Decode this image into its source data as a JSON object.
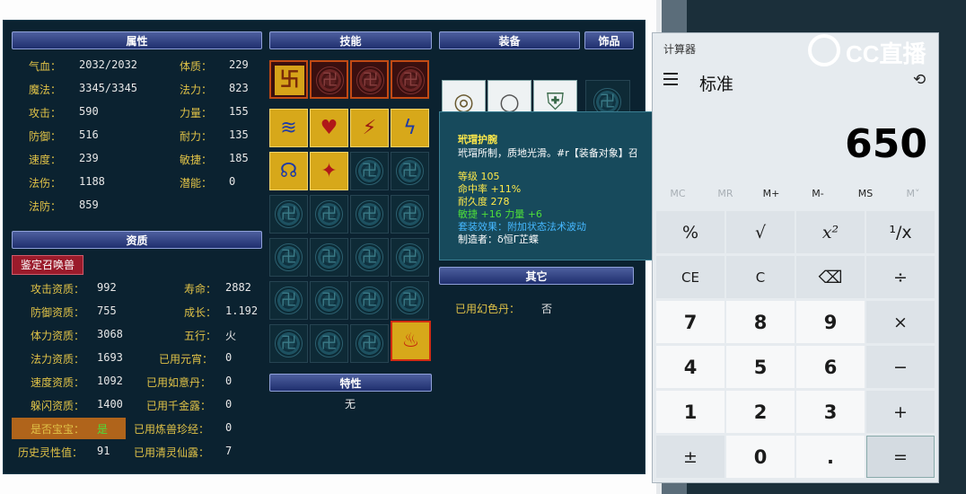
{
  "game": {
    "headers": {
      "attributes": "属性",
      "skills": "技能",
      "equipment": "装备",
      "accessories": "饰品",
      "aptitude": "资质",
      "other": "其它",
      "traits": "特性"
    },
    "attributes": [
      {
        "label": "气血：",
        "value": "2032/2032"
      },
      {
        "label": "魔法：",
        "value": "3345/3345"
      },
      {
        "label": "攻击：",
        "value": "590"
      },
      {
        "label": "防御：",
        "value": "516"
      },
      {
        "label": "速度：",
        "value": "239"
      },
      {
        "label": "法伤：",
        "value": "1188"
      },
      {
        "label": "法防：",
        "value": "859"
      }
    ],
    "attributes_right": [
      {
        "label": "体质：",
        "value": "229"
      },
      {
        "label": "法力：",
        "value": "823"
      },
      {
        "label": "力量：",
        "value": "155"
      },
      {
        "label": "耐力：",
        "value": "135"
      },
      {
        "label": "敏捷：",
        "value": "185"
      },
      {
        "label": "潜能：",
        "value": "0"
      }
    ],
    "appraise_button": "鉴定召唤兽",
    "aptitude_left": [
      {
        "label": "攻击资质：",
        "value": "992"
      },
      {
        "label": "防御资质：",
        "value": "755"
      },
      {
        "label": "体力资质：",
        "value": "3068"
      },
      {
        "label": "法力资质：",
        "value": "1693"
      },
      {
        "label": "速度资质：",
        "value": "1092"
      },
      {
        "label": "躲闪资质：",
        "value": "1400"
      },
      {
        "label": "是否宝宝：",
        "value": "是"
      },
      {
        "label": "历史灵性值：",
        "value": "91"
      }
    ],
    "aptitude_right": [
      {
        "label": "寿命：",
        "value": "2882"
      },
      {
        "label": "成长：",
        "value": "1.192"
      },
      {
        "label": "五行：",
        "value": "火"
      },
      {
        "label": "已用元宵：",
        "value": "0"
      },
      {
        "label": "已用如意丹：",
        "value": "0"
      },
      {
        "label": "已用千金露：",
        "value": "0"
      },
      {
        "label": "已用炼兽珍经：",
        "value": "0"
      },
      {
        "label": "已用清灵仙露：",
        "value": "7"
      }
    ],
    "other": {
      "label": "已用幻色丹：",
      "value": "否"
    },
    "traits_value": "无",
    "tooltip": {
      "name": "玳瑁护腕",
      "desc": "玳瑁所制，质地光滑。#r【装备对象】召",
      "level": "等级 105",
      "hit": "命中率 +11%",
      "durability": "耐久度 278",
      "stats": "敏捷 +16 力量 +6",
      "set_effect": "套装效果：附加状态法术波动",
      "maker": "制造者：δ恒Γ芷蝶"
    }
  },
  "calculator": {
    "title": "计算器",
    "mode": "标准",
    "display": "650",
    "memory": [
      "MC",
      "MR",
      "M+",
      "M-",
      "MS",
      "M˅"
    ],
    "keys": [
      [
        "%",
        "√",
        "x²",
        "¹/x"
      ],
      [
        "CE",
        "C",
        "⌫",
        "÷"
      ],
      [
        "7",
        "8",
        "9",
        "×"
      ],
      [
        "4",
        "5",
        "6",
        "−"
      ],
      [
        "1",
        "2",
        "3",
        "+"
      ],
      [
        "±",
        "0",
        ".",
        "="
      ]
    ]
  },
  "logo": {
    "text": "CC直播"
  },
  "colors": {
    "label": "#e0c247",
    "value": "#e8e8e8",
    "header": "#2f3f7e",
    "panel": "#0b2230",
    "calc_bg": "#e6ebef"
  }
}
